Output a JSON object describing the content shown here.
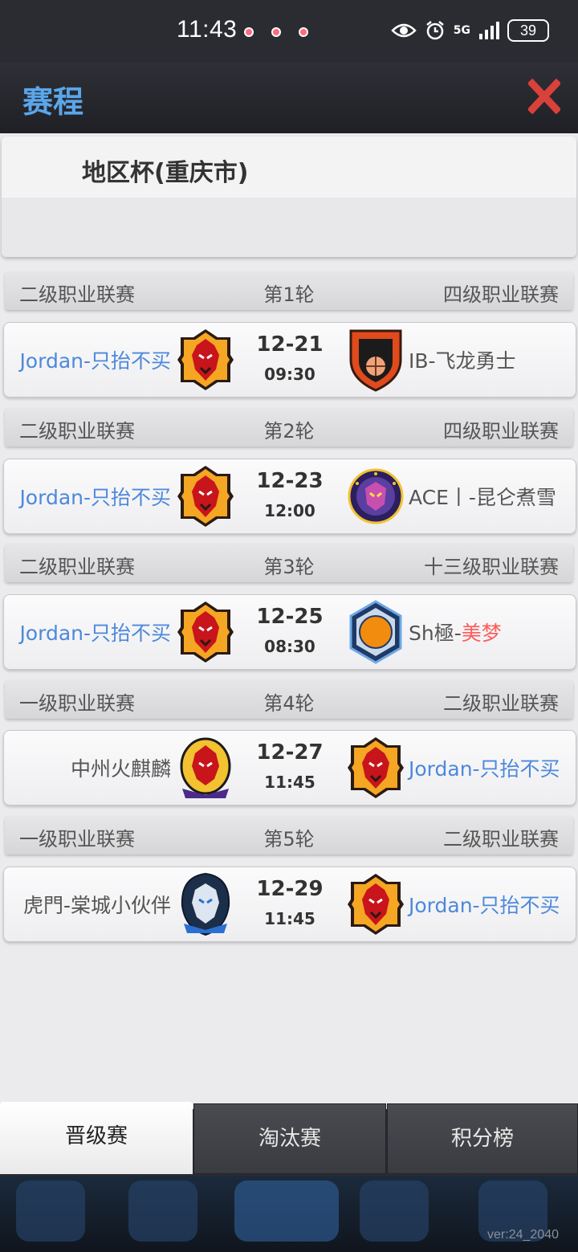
{
  "status_bar": {
    "time": "11:43",
    "network": "5G",
    "battery": "39"
  },
  "header": {
    "title": "赛程"
  },
  "banner": {
    "title": "地区杯(重庆市)"
  },
  "rounds": [
    {
      "left_league": "二级职业联赛",
      "round": "第1轮",
      "right_league": "四级职业联赛",
      "home": "Jordan-只抬不买",
      "away": "IB-飞龙勇士",
      "date": "12-21",
      "time": "09:30"
    },
    {
      "left_league": "二级职业联赛",
      "round": "第2轮",
      "right_league": "四级职业联赛",
      "home": "Jordan-只抬不买",
      "away": "ACE丨-昆仑煮雪",
      "date": "12-23",
      "time": "12:00"
    },
    {
      "left_league": "二级职业联赛",
      "round": "第3轮",
      "right_league": "十三级职业联赛",
      "home": "Jordan-只抬不买",
      "away_a": "Sh極-",
      "away_b": "美梦",
      "date": "12-25",
      "time": "08:30"
    },
    {
      "left_league": "一级职业联赛",
      "round": "第4轮",
      "right_league": "二级职业联赛",
      "home": "中州火麒麟",
      "away": "Jordan-只抬不买",
      "date": "12-27",
      "time": "11:45"
    },
    {
      "left_league": "一级职业联赛",
      "round": "第5轮",
      "right_league": "二级职业联赛",
      "home": "虎門-棠城小伙伴",
      "away": "Jordan-只抬不买",
      "date": "12-29",
      "time": "11:45"
    }
  ],
  "tabs": [
    "晋级赛",
    "淘汰赛",
    "积分榜"
  ],
  "version": "ver:24_2040",
  "colors": {
    "title_blue": "#5aa6ea",
    "team_blue": "#4d88db",
    "highlight_red": "#ff5a5a",
    "close_red": "#d9413a"
  }
}
